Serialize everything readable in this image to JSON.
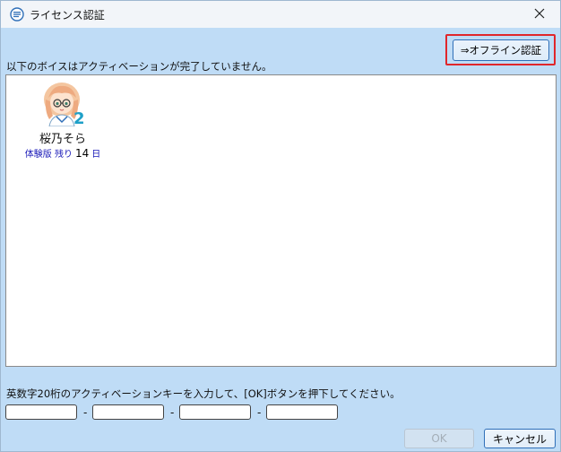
{
  "window": {
    "title": "ライセンス認証",
    "icon": "speech-bubble-icon",
    "close_icon": "close-icon",
    "close_glyph": "✕"
  },
  "offline_button": {
    "label": "⇒オフライン認証",
    "highlight_color": "#e0262b"
  },
  "status_message": "以下のボイスはアクティベーションが完了していません。",
  "voices": [
    {
      "name": "桜乃そら",
      "avatar_icon": "character-avatar-icon",
      "version_badge": "2",
      "trial_label": "体験版 残り",
      "trial_days": "14",
      "trial_unit": "日"
    }
  ],
  "activation": {
    "instruction": "英数字20桁のアクティベーションキーを入力して、[OK]ボタンを押下してください。",
    "key_fields": [
      "",
      "",
      "",
      ""
    ],
    "separator": "-"
  },
  "buttons": {
    "ok_label": "OK",
    "cancel_label": "キャンセル"
  },
  "colors": {
    "window_background": "#bfdcf6",
    "title_bar": "#f2f5f9",
    "accent_border": "#2f6fb8",
    "trial_text": "#1a1ab8"
  }
}
